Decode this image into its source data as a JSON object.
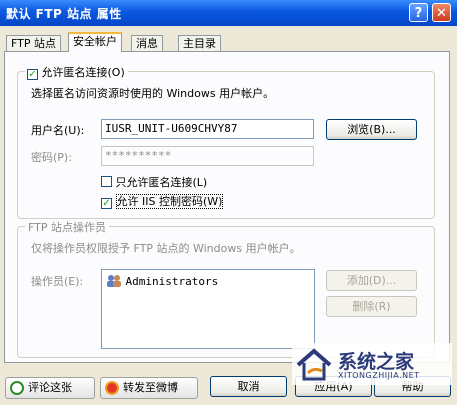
{
  "window": {
    "title": "默认 FTP 站点 属性",
    "help_glyph": "?",
    "close_glyph": "✕"
  },
  "tabs": [
    {
      "label": "FTP 站点"
    },
    {
      "label": "安全帐户",
      "active": true
    },
    {
      "label": "消息"
    },
    {
      "label": "主目录"
    }
  ],
  "anonymous": {
    "allow_label": "允许匿名连接(O)",
    "allow_checked": true,
    "description": "选择匿名访问资源时使用的 Windows 用户帐户。",
    "username_label": "用户名(U):",
    "username_value": "IUSR_UNIT-U609CHVY87",
    "browse_label": "浏览(B)...",
    "password_label": "密码(P):",
    "password_value": "**********",
    "only_anonymous_label": "只允许匿名连接(L)",
    "only_anonymous_checked": false,
    "iis_password_label": "允许 IIS 控制密码(W)",
    "iis_password_checked": true
  },
  "operators": {
    "group_title": "FTP 站点操作员",
    "description": "仅将操作员权限授予 FTP 站点的 Windows 用户帐户。",
    "label": "操作员(E):",
    "items": [
      "Administrators"
    ],
    "add_label": "添加(D)...",
    "remove_label": "删除(R)"
  },
  "footer": {
    "comment_label": "评论这张",
    "share_label": "转发至微博",
    "cancel_label": "取消",
    "apply_label": "应用(A)",
    "help_label": "帮助"
  },
  "watermark": {
    "text": "系统之家",
    "sub": "XITONGZHIJIA.NET"
  }
}
